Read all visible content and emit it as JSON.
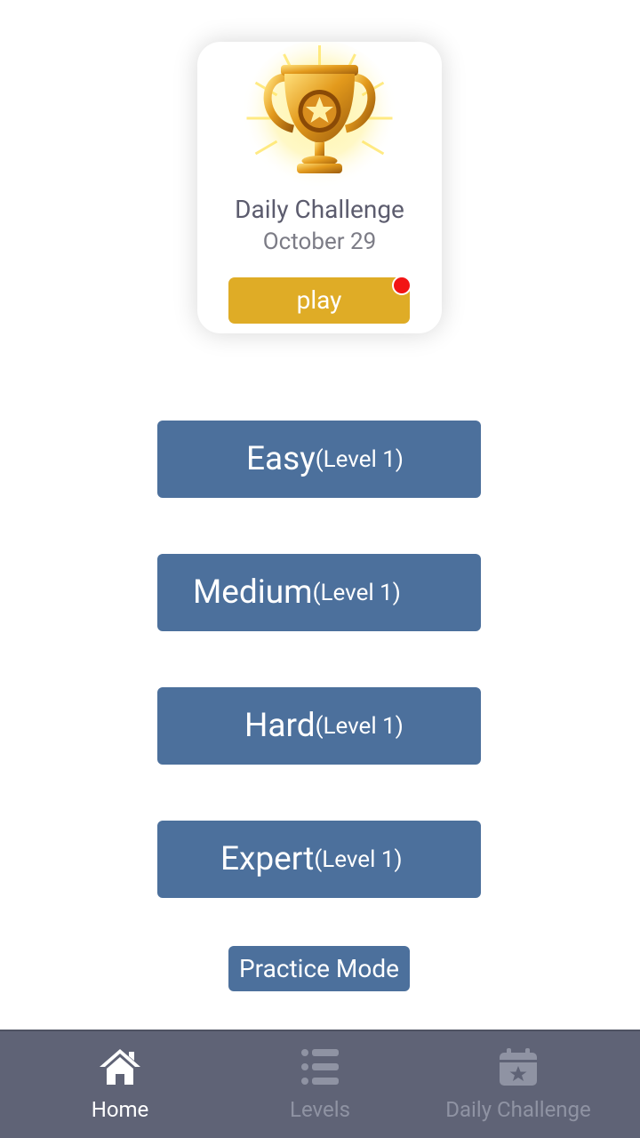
{
  "daily_card": {
    "title": "Daily Challenge",
    "date": "October 29",
    "play_label": "play",
    "trophy_icon": "trophy-icon",
    "notification_color": "#f21515"
  },
  "levels": [
    {
      "name": "Easy",
      "sub": "(Level 1)"
    },
    {
      "name": "Medium",
      "sub": "(Level 1)"
    },
    {
      "name": "Hard",
      "sub": "(Level 1)"
    },
    {
      "name": "Expert",
      "sub": "(Level 1)"
    }
  ],
  "practice_label": "Practice Mode",
  "tabs": [
    {
      "label": "Home",
      "icon": "home-icon",
      "active": true
    },
    {
      "label": "Levels",
      "icon": "list-icon",
      "active": false
    },
    {
      "label": "Daily Challenge",
      "icon": "calendar-icon",
      "active": false
    }
  ],
  "colors": {
    "accent": "#4c709c",
    "play": "#dfac26",
    "tabbar": "#5f6376"
  }
}
